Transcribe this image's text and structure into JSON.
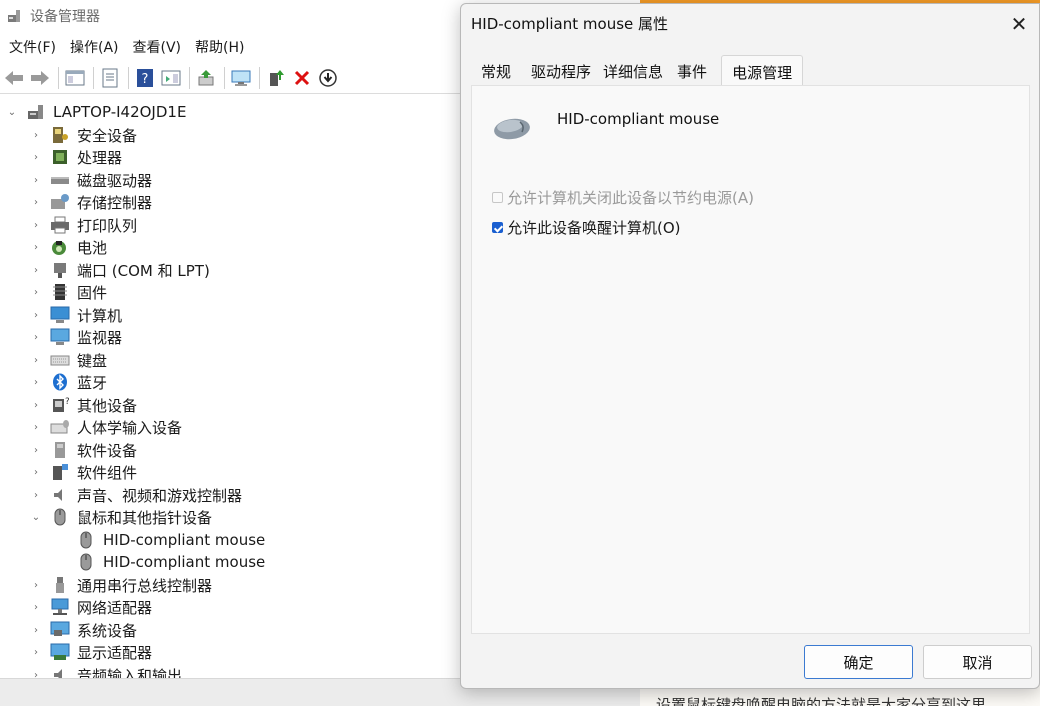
{
  "device_manager": {
    "title": "设备管理器",
    "menu": [
      "文件(F)",
      "操作(A)",
      "查看(V)",
      "帮助(H)"
    ],
    "computer_name": "LAPTOP-I42OJD1E",
    "categories": [
      {
        "label": "安全设备",
        "icon": "security-icon",
        "expanded": false
      },
      {
        "label": "处理器",
        "icon": "processor-icon",
        "expanded": false
      },
      {
        "label": "磁盘驱动器",
        "icon": "disk-drive-icon",
        "expanded": false
      },
      {
        "label": "存储控制器",
        "icon": "storage-controller-icon",
        "expanded": false
      },
      {
        "label": "打印队列",
        "icon": "printer-icon",
        "expanded": false
      },
      {
        "label": "电池",
        "icon": "battery-icon",
        "expanded": false
      },
      {
        "label": "端口 (COM 和 LPT)",
        "icon": "port-icon",
        "expanded": false
      },
      {
        "label": "固件",
        "icon": "firmware-icon",
        "expanded": false
      },
      {
        "label": "计算机",
        "icon": "computer-icon",
        "expanded": false
      },
      {
        "label": "监视器",
        "icon": "monitor-icon",
        "expanded": false
      },
      {
        "label": "键盘",
        "icon": "keyboard-icon",
        "expanded": false
      },
      {
        "label": "蓝牙",
        "icon": "bluetooth-icon",
        "expanded": false
      },
      {
        "label": "其他设备",
        "icon": "other-device-icon",
        "expanded": false
      },
      {
        "label": "人体学输入设备",
        "icon": "hid-icon",
        "expanded": false
      },
      {
        "label": "软件设备",
        "icon": "software-device-icon",
        "expanded": false
      },
      {
        "label": "软件组件",
        "icon": "software-component-icon",
        "expanded": false
      },
      {
        "label": "声音、视频和游戏控制器",
        "icon": "audio-icon",
        "expanded": false
      },
      {
        "label": "鼠标和其他指针设备",
        "icon": "mouse-icon",
        "expanded": true,
        "children": [
          "HID-compliant mouse",
          "HID-compliant mouse"
        ]
      },
      {
        "label": "通用串行总线控制器",
        "icon": "usb-icon",
        "expanded": false
      },
      {
        "label": "网络适配器",
        "icon": "network-icon",
        "expanded": false
      },
      {
        "label": "系统设备",
        "icon": "system-device-icon",
        "expanded": false
      },
      {
        "label": "显示适配器",
        "icon": "display-adapter-icon",
        "expanded": false
      },
      {
        "label": "音频输入和输出",
        "icon": "audio-io-icon",
        "expanded": false
      }
    ]
  },
  "dialog": {
    "title": "HID-compliant mouse 属性",
    "tabs": [
      "常规",
      "驱动程序",
      "详细信息",
      "事件",
      "电源管理"
    ],
    "active_tab": 4,
    "device_name": "HID-compliant mouse",
    "options": [
      {
        "label": "允许计算机关闭此设备以节约电源(A)",
        "checked": false,
        "enabled": false
      },
      {
        "label": "允许此设备唤醒计算机(O)",
        "checked": true,
        "enabled": true
      }
    ],
    "ok_label": "确定",
    "cancel_label": "取消"
  },
  "background_text": "设置鼠标键盘唤醒电脑的方法就是大家分享到这里",
  "colors": {
    "accent": "#1a5fd0",
    "orange_strip": "#f29a26"
  }
}
